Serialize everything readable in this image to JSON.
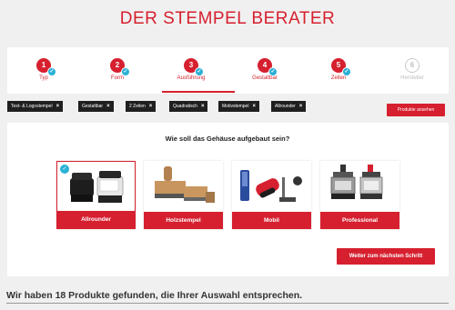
{
  "title": "DER STEMPEL BERATER",
  "steps": [
    {
      "num": "1",
      "label": "Typ",
      "done": true
    },
    {
      "num": "2",
      "label": "Form",
      "done": true
    },
    {
      "num": "3",
      "label": "Ausführung",
      "done": true
    },
    {
      "num": "4",
      "label": "Gestaltbar",
      "done": true
    },
    {
      "num": "5",
      "label": "Zeilen",
      "done": true
    },
    {
      "num": "6",
      "label": "Hersteller",
      "done": false
    }
  ],
  "active_step": "Ausführung",
  "filters": [
    "Text- & Logostempel",
    "Gestaltbar",
    "2 Zeilen",
    "Quadratisch",
    "Motivstempel",
    "Allrounder"
  ],
  "remove_symbol": "×",
  "show_products_label": "Produkte ansehen",
  "question": "Wie soll das Gehäuse aufgebaut sein?",
  "options": [
    {
      "label": "Allrounder",
      "selected": true
    },
    {
      "label": "Holzstempel",
      "selected": false
    },
    {
      "label": "Mobil",
      "selected": false
    },
    {
      "label": "Professional",
      "selected": false
    }
  ],
  "next_label": "Weiter zum nächsten Schritt",
  "results_text": "Wir haben 18 Produkte gefunden, die Ihrer Auswahl entsprechen.",
  "check_symbol": "✓",
  "colors": {
    "accent": "#d6202f",
    "check": "#2cb0d6",
    "chip": "#1f1f1f"
  }
}
